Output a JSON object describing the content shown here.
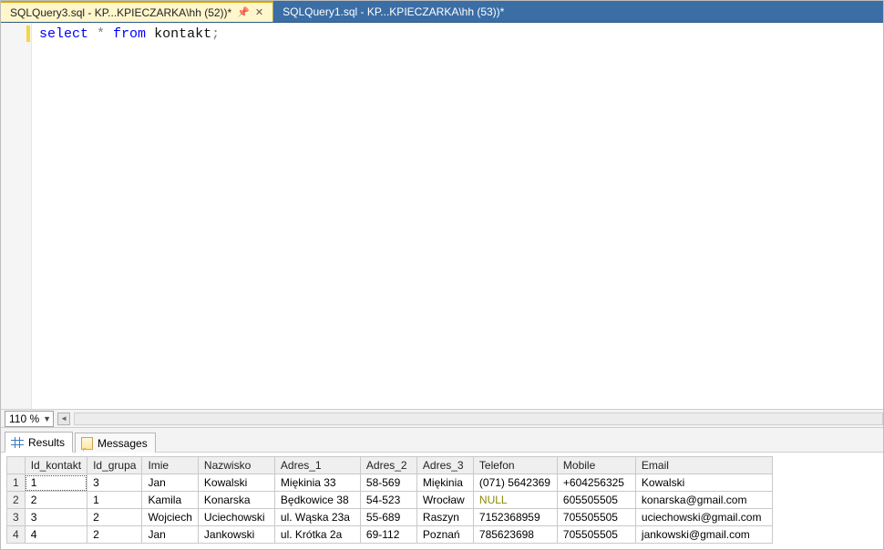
{
  "tabs": [
    {
      "label": "SQLQuery3.sql - KP...KPIECZARKA\\hh (52))*",
      "active": true
    },
    {
      "label": "SQLQuery1.sql - KP...KPIECZARKA\\hh (53))*",
      "active": false
    }
  ],
  "sql": {
    "kw_select": "select",
    "star": " * ",
    "kw_from": "from",
    "space": " ",
    "ident": "kontakt",
    "semi": ";"
  },
  "zoom": "110 %",
  "result_tabs": {
    "results": "Results",
    "messages": "Messages"
  },
  "columns": [
    "Id_kontakt",
    "Id_grupa",
    "Imie",
    "Nazwisko",
    "Adres_1",
    "Adres_2",
    "Adres_3",
    "Telefon",
    "Mobile",
    "Email"
  ],
  "rows": [
    {
      "n": "1",
      "Id_kontakt": "1",
      "Id_grupa": "3",
      "Imie": "Jan",
      "Nazwisko": "Kowalski",
      "Adres_1": "Miękinia 33",
      "Adres_2": "58-569",
      "Adres_3": "Miękinia",
      "Telefon": "(071) 5642369",
      "Mobile": "+604256325",
      "Email": "Kowalski"
    },
    {
      "n": "2",
      "Id_kontakt": "2",
      "Id_grupa": "1",
      "Imie": "Kamila",
      "Nazwisko": "Konarska",
      "Adres_1": "Będkowice 38",
      "Adres_2": "54-523",
      "Adres_3": "Wrocław",
      "Telefon": "NULL",
      "Mobile": "605505505",
      "Email": "konarska@gmail.com"
    },
    {
      "n": "3",
      "Id_kontakt": "3",
      "Id_grupa": "2",
      "Imie": "Wojciech",
      "Nazwisko": "Uciechowski",
      "Adres_1": "ul. Wąska 23a",
      "Adres_2": "55-689",
      "Adres_3": "Raszyn",
      "Telefon": "7152368959",
      "Mobile": "705505505",
      "Email": "uciechowski@gmail.com"
    },
    {
      "n": "4",
      "Id_kontakt": "4",
      "Id_grupa": "2",
      "Imie": "Jan",
      "Nazwisko": "Jankowski",
      "Adres_1": "ul. Krótka 2a",
      "Adres_2": "69-112",
      "Adres_3": "Poznań",
      "Telefon": "785623698",
      "Mobile": "705505505",
      "Email": "jankowski@gmail.com"
    }
  ]
}
